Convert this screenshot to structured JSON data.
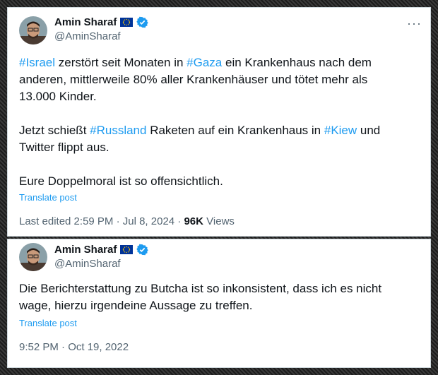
{
  "tweets": [
    {
      "author": "Amin Sharaf",
      "handle": "@AminSharaf",
      "more": "···",
      "p1": {
        "t1": "#Israel",
        "t2": " zerstört seit Monaten in ",
        "t3": "#Gaza",
        "t4": " ein Krankenhaus nach dem anderen, mittlerweile 80% aller Krankenhäuser und tötet mehr als 13.000 Kinder."
      },
      "p2": {
        "t1": "Jetzt schießt ",
        "t2": "#Russland",
        "t3": " Raketen auf ein Krankenhaus in ",
        "t4": "#Kiew",
        "t5": " und Twitter flippt aus."
      },
      "p3": "Eure Doppelmoral ist so offensichtlich.",
      "translate": "Translate post",
      "meta_prefix": "Last edited 2:59 PM · Jul 8, 2024 · ",
      "views_count": "96K",
      "views_label": " Views"
    },
    {
      "author": "Amin Sharaf",
      "handle": "@AminSharaf",
      "text": "Die Berichterstattung zu Butcha ist so inkonsistent, dass ich es nicht wage, hierzu irgendeine Aussage zu treffen.",
      "translate": "Translate post",
      "timestamp": "9:52 PM · Oct 19, 2022"
    }
  ],
  "colors": {
    "link": "#1d9bf0",
    "text": "#0f1419",
    "secondary": "#536471",
    "verified": "#1d9bf0",
    "eu_blue": "#003399",
    "eu_gold": "#ffcc00"
  },
  "icons": {
    "verified": "verified-badge-icon",
    "flag": "eu-flag-icon",
    "more": "more-options-icon"
  }
}
